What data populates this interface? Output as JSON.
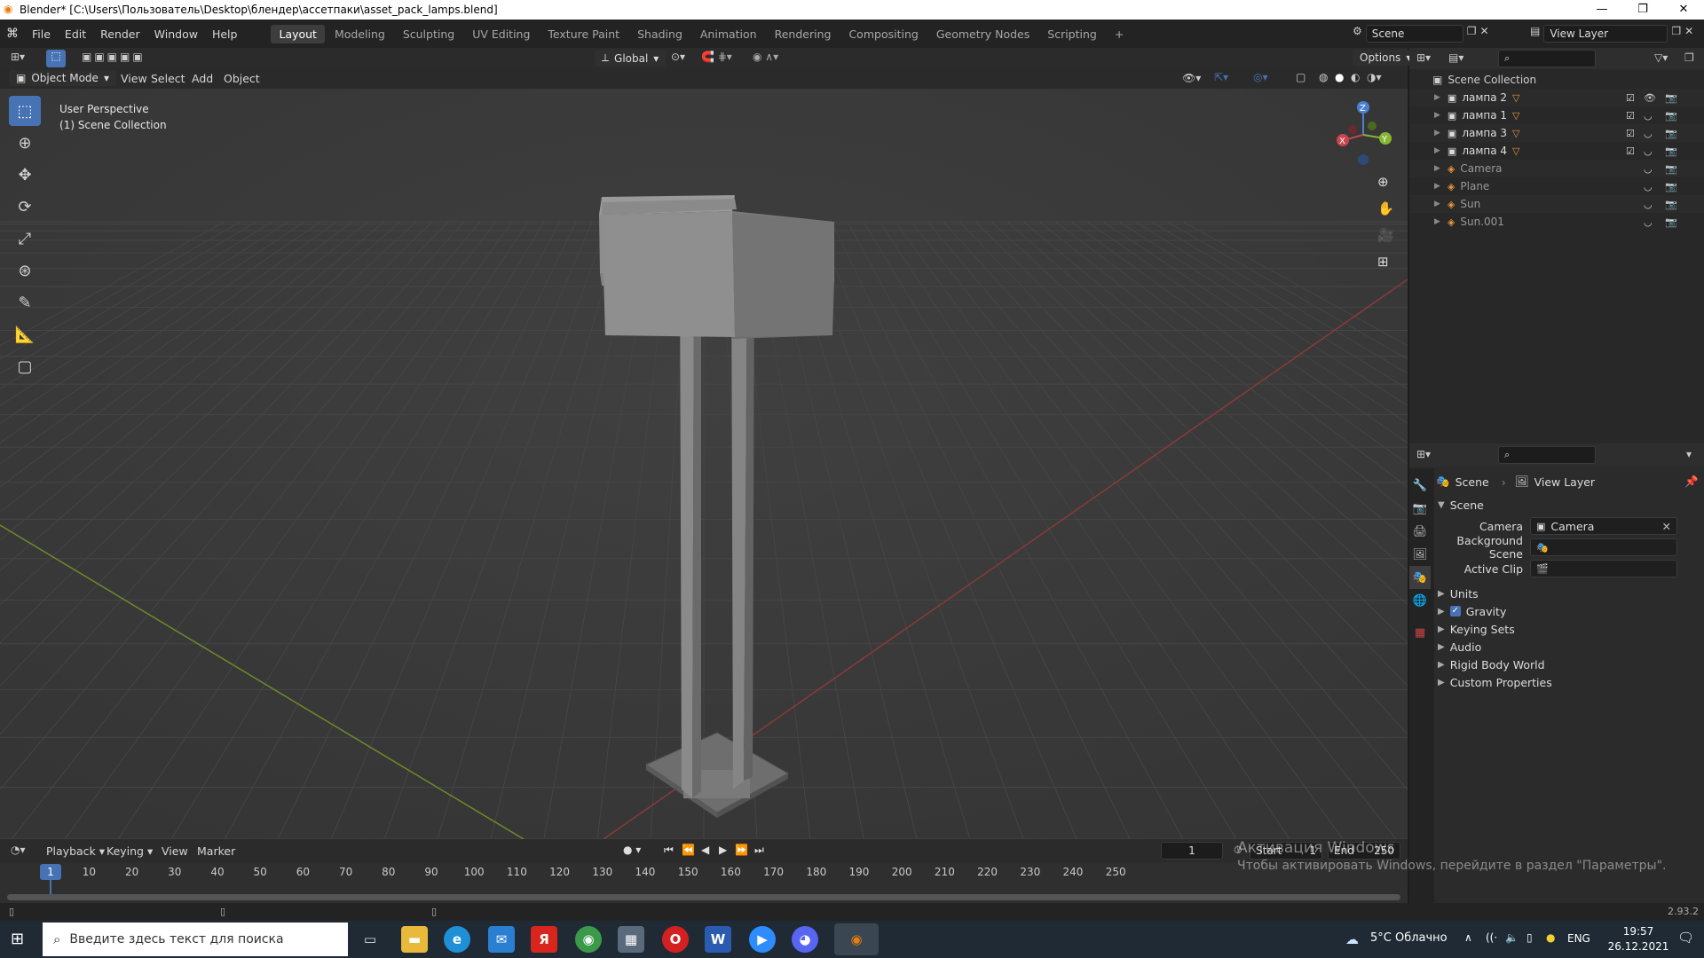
{
  "window": {
    "title": "Blender* [C:\\Users\\Пользователь\\Desktop\\блендер\\ассетпаки\\asset_pack_lamps.blend]",
    "minimize": "—",
    "maximize": "❐",
    "close": "✕"
  },
  "menu": [
    "File",
    "Edit",
    "Render",
    "Window",
    "Help"
  ],
  "workspaces": [
    "Layout",
    "Modeling",
    "Sculpting",
    "UV Editing",
    "Texture Paint",
    "Shading",
    "Animation",
    "Rendering",
    "Compositing",
    "Geometry Nodes",
    "Scripting"
  ],
  "workspace_add": "+",
  "topbar": {
    "scene": "Scene",
    "view_layer": "View Layer"
  },
  "tool_header": {
    "orientation": "Global",
    "options": "Options"
  },
  "viewport_header": {
    "mode": "Object Mode",
    "menus": [
      "View",
      "Select",
      "Add",
      "Object"
    ]
  },
  "viewport": {
    "perspective": "User Perspective",
    "collection": "(1) Scene Collection",
    "gizmo": {
      "z": "Z",
      "y": "Y",
      "x": "X"
    },
    "watermark_line1": "Активация Windows",
    "watermark_line2": "Чтобы активировать Windows, перейдите в раздел \"Параметры\"."
  },
  "outliner": {
    "root": "Scene Collection",
    "items": [
      {
        "name": "лампа 2",
        "type": "collection"
      },
      {
        "name": "лампа 1",
        "type": "collection"
      },
      {
        "name": "лампа 3",
        "type": "collection"
      },
      {
        "name": "лампа 4",
        "type": "collection"
      },
      {
        "name": "Camera",
        "type": "object"
      },
      {
        "name": "Plane",
        "type": "object"
      },
      {
        "name": "Sun",
        "type": "object"
      },
      {
        "name": "Sun.001",
        "type": "object"
      }
    ]
  },
  "properties": {
    "breadcrumb_scene": "Scene",
    "breadcrumb_viewlayer": "View Layer",
    "panel_title": "Scene",
    "camera_label": "Camera",
    "camera_value": "Camera",
    "bg_scene_label": "Background Scene",
    "active_clip_label": "Active Clip",
    "subpanels": [
      "Units",
      "Gravity",
      "Keying Sets",
      "Audio",
      "Rigid Body World",
      "Custom Properties"
    ]
  },
  "timeline": {
    "menus": [
      "Playback",
      "Keying",
      "View",
      "Marker"
    ],
    "current_frame": "1",
    "start_label": "Start",
    "start_value": "1",
    "end_label": "End",
    "end_value": "250",
    "ticks": [
      "10",
      "20",
      "30",
      "40",
      "50",
      "60",
      "70",
      "80",
      "90",
      "100",
      "110",
      "120",
      "130",
      "140",
      "150",
      "160",
      "170",
      "180",
      "190",
      "200",
      "210",
      "220",
      "230",
      "240",
      "250"
    ],
    "playhead": "1"
  },
  "statusbar": {
    "version": "2.93.2"
  },
  "taskbar": {
    "search_placeholder": "Введите здесь текст для поиска",
    "weather": "5°C Облачно",
    "lang": "ENG",
    "time": "19:57",
    "date": "26.12.2021"
  },
  "colors": {
    "accent": "#4772b3",
    "x_axis": "#c8454f",
    "y_axis": "#86b532",
    "z_axis": "#4a7fd0",
    "orange": "#e8943a"
  }
}
